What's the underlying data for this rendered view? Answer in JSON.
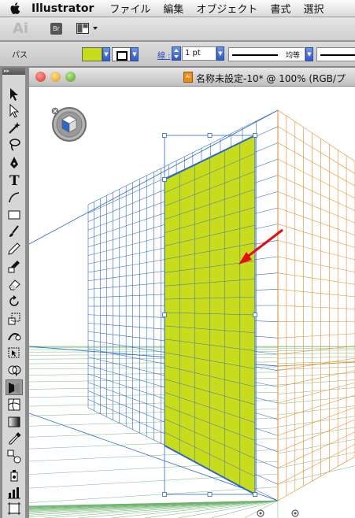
{
  "menubar": {
    "app_name": "Illustrator",
    "items": [
      "ファイル",
      "編集",
      "オブジェクト",
      "書式",
      "選択"
    ]
  },
  "appbar": {
    "logo": "Ai",
    "bridge_label": "Br"
  },
  "control": {
    "selection_label": "パス",
    "fill_color": "#c8dc1e",
    "stroke_label": "線 :",
    "stroke_weight": "1 pt",
    "profile_label": "均等"
  },
  "document": {
    "title": "名称未設定-10* @ 100% (RGB/プ"
  },
  "colors": {
    "left_grid": "#2d67c9",
    "right_grid": "#e58a2a",
    "ground_grid": "#6bb36b",
    "plane_fill": "#c8dc1e",
    "plane_stroke": "#2a7a2a",
    "annotation_arrow": "#e01010"
  },
  "tools": [
    "selection-tool",
    "direct-selection-tool",
    "magic-wand-tool",
    "lasso-tool",
    "pen-tool",
    "type-tool",
    "line-tool",
    "rectangle-tool",
    "paintbrush-tool",
    "pencil-tool",
    "blob-brush-tool",
    "eraser-tool",
    "rotate-tool",
    "scale-tool",
    "warp-tool",
    "free-transform-tool",
    "shape-builder-tool",
    "perspective-grid-tool",
    "mesh-tool",
    "gradient-tool",
    "eyedropper-tool",
    "blend-tool",
    "symbol-sprayer-tool",
    "column-graph-tool",
    "artboard-tool"
  ]
}
